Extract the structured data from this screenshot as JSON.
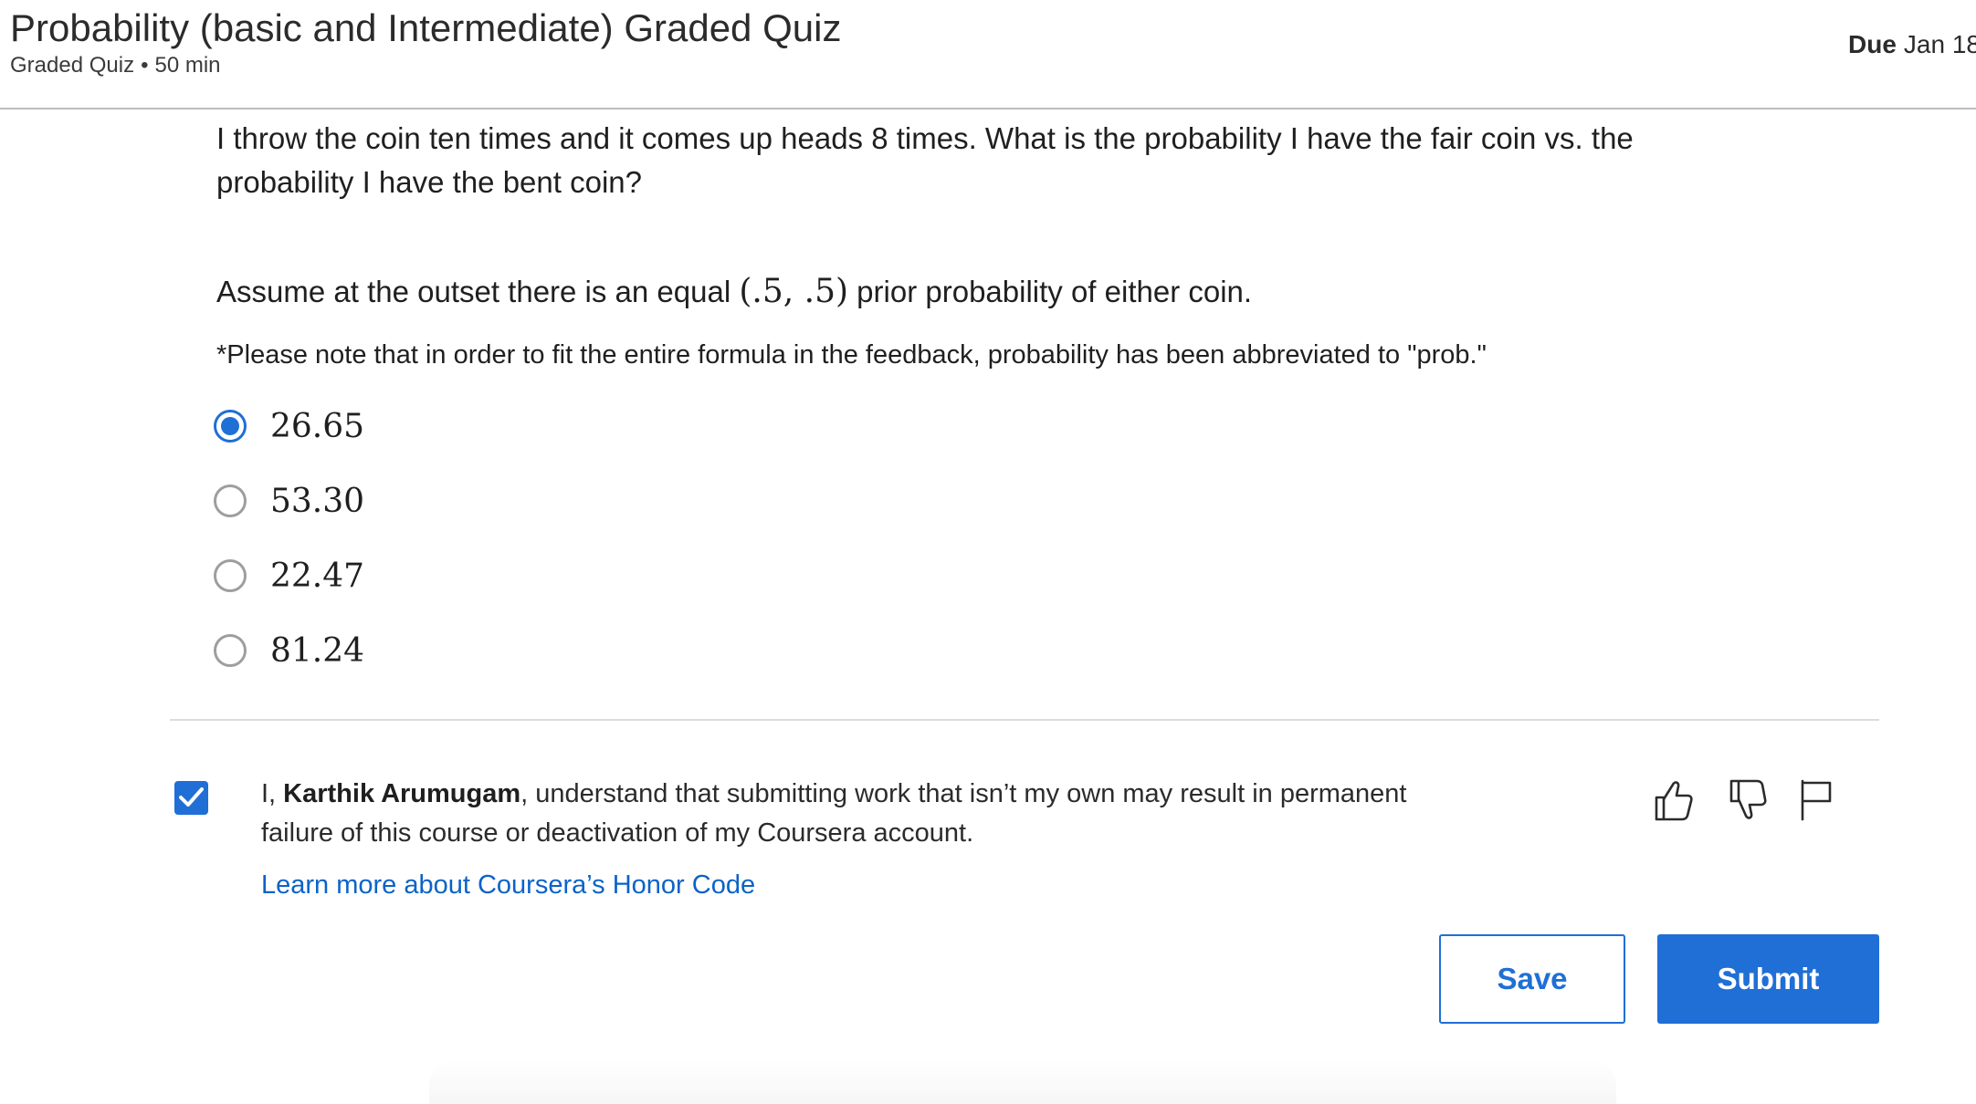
{
  "header": {
    "title": "Probability (basic and Intermediate) Graded Quiz",
    "type": "Graded Quiz",
    "separator": "•",
    "duration": "50 min",
    "due_label": "Due",
    "due_date": "Jan 18"
  },
  "question": {
    "text": "I throw the coin ten times and it comes up heads 8 times. What is the probability I have the fair coin vs. the probability I have the bent coin?",
    "assume_prefix": "Assume at the outset there is an equal ",
    "assume_math": "(.5, .5)",
    "assume_suffix": " prior probability of either coin.",
    "note": "*Please note that in order to fit the entire formula in the feedback, probability has been abbreviated to \"prob.\""
  },
  "options": [
    {
      "label": "26.65",
      "selected": true
    },
    {
      "label": "53.30",
      "selected": false
    },
    {
      "label": "22.47",
      "selected": false
    },
    {
      "label": "81.24",
      "selected": false
    }
  ],
  "honor": {
    "checked": true,
    "prefix": "I, ",
    "name": "Karthik Arumugam",
    "suffix": ", understand that submitting work that isn’t my own may result in permanent failure of this course or deactivation of my Coursera account.",
    "link": "Learn more about Coursera’s Honor Code"
  },
  "icons": {
    "like": "thumbs-up-icon",
    "dislike": "thumbs-down-icon",
    "flag": "flag-icon"
  },
  "buttons": {
    "save": "Save",
    "submit": "Submit"
  },
  "colors": {
    "accent": "#1f6fd6",
    "link": "#0b63c7"
  }
}
